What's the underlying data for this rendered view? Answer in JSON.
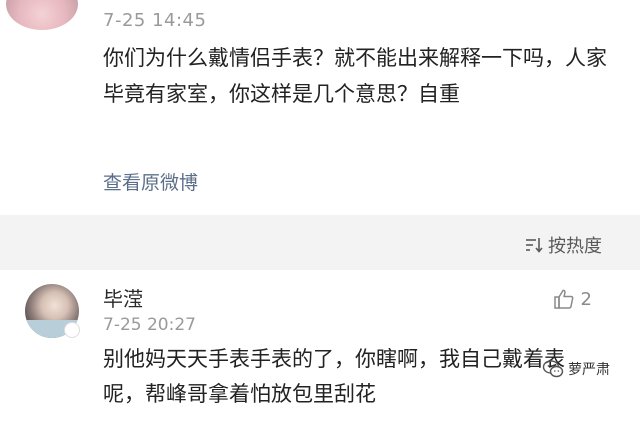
{
  "post": {
    "time": "7-25 14:45",
    "text": "你们为什么戴情侣手表？就不能出来解释一下吗，人家毕竟有家室，你这样是几个意思？自重",
    "view_original": "查看原微博"
  },
  "sort": {
    "label": "按热度",
    "icon": "sort-icon"
  },
  "comment": {
    "username": "毕滢",
    "time": "7-25 20:27",
    "text": "别他妈天天手表手表的了，你瞎啊，我自己戴着表呢，帮峰哥拿着怕放包里刮花",
    "likes": "2",
    "like_icon": "thumbs-up-icon"
  },
  "watermark": {
    "text": "萝严肃"
  },
  "colors": {
    "link": "#5c6f8a",
    "muted": "#9a9a9a",
    "bar_bg": "#f3f3f3"
  }
}
